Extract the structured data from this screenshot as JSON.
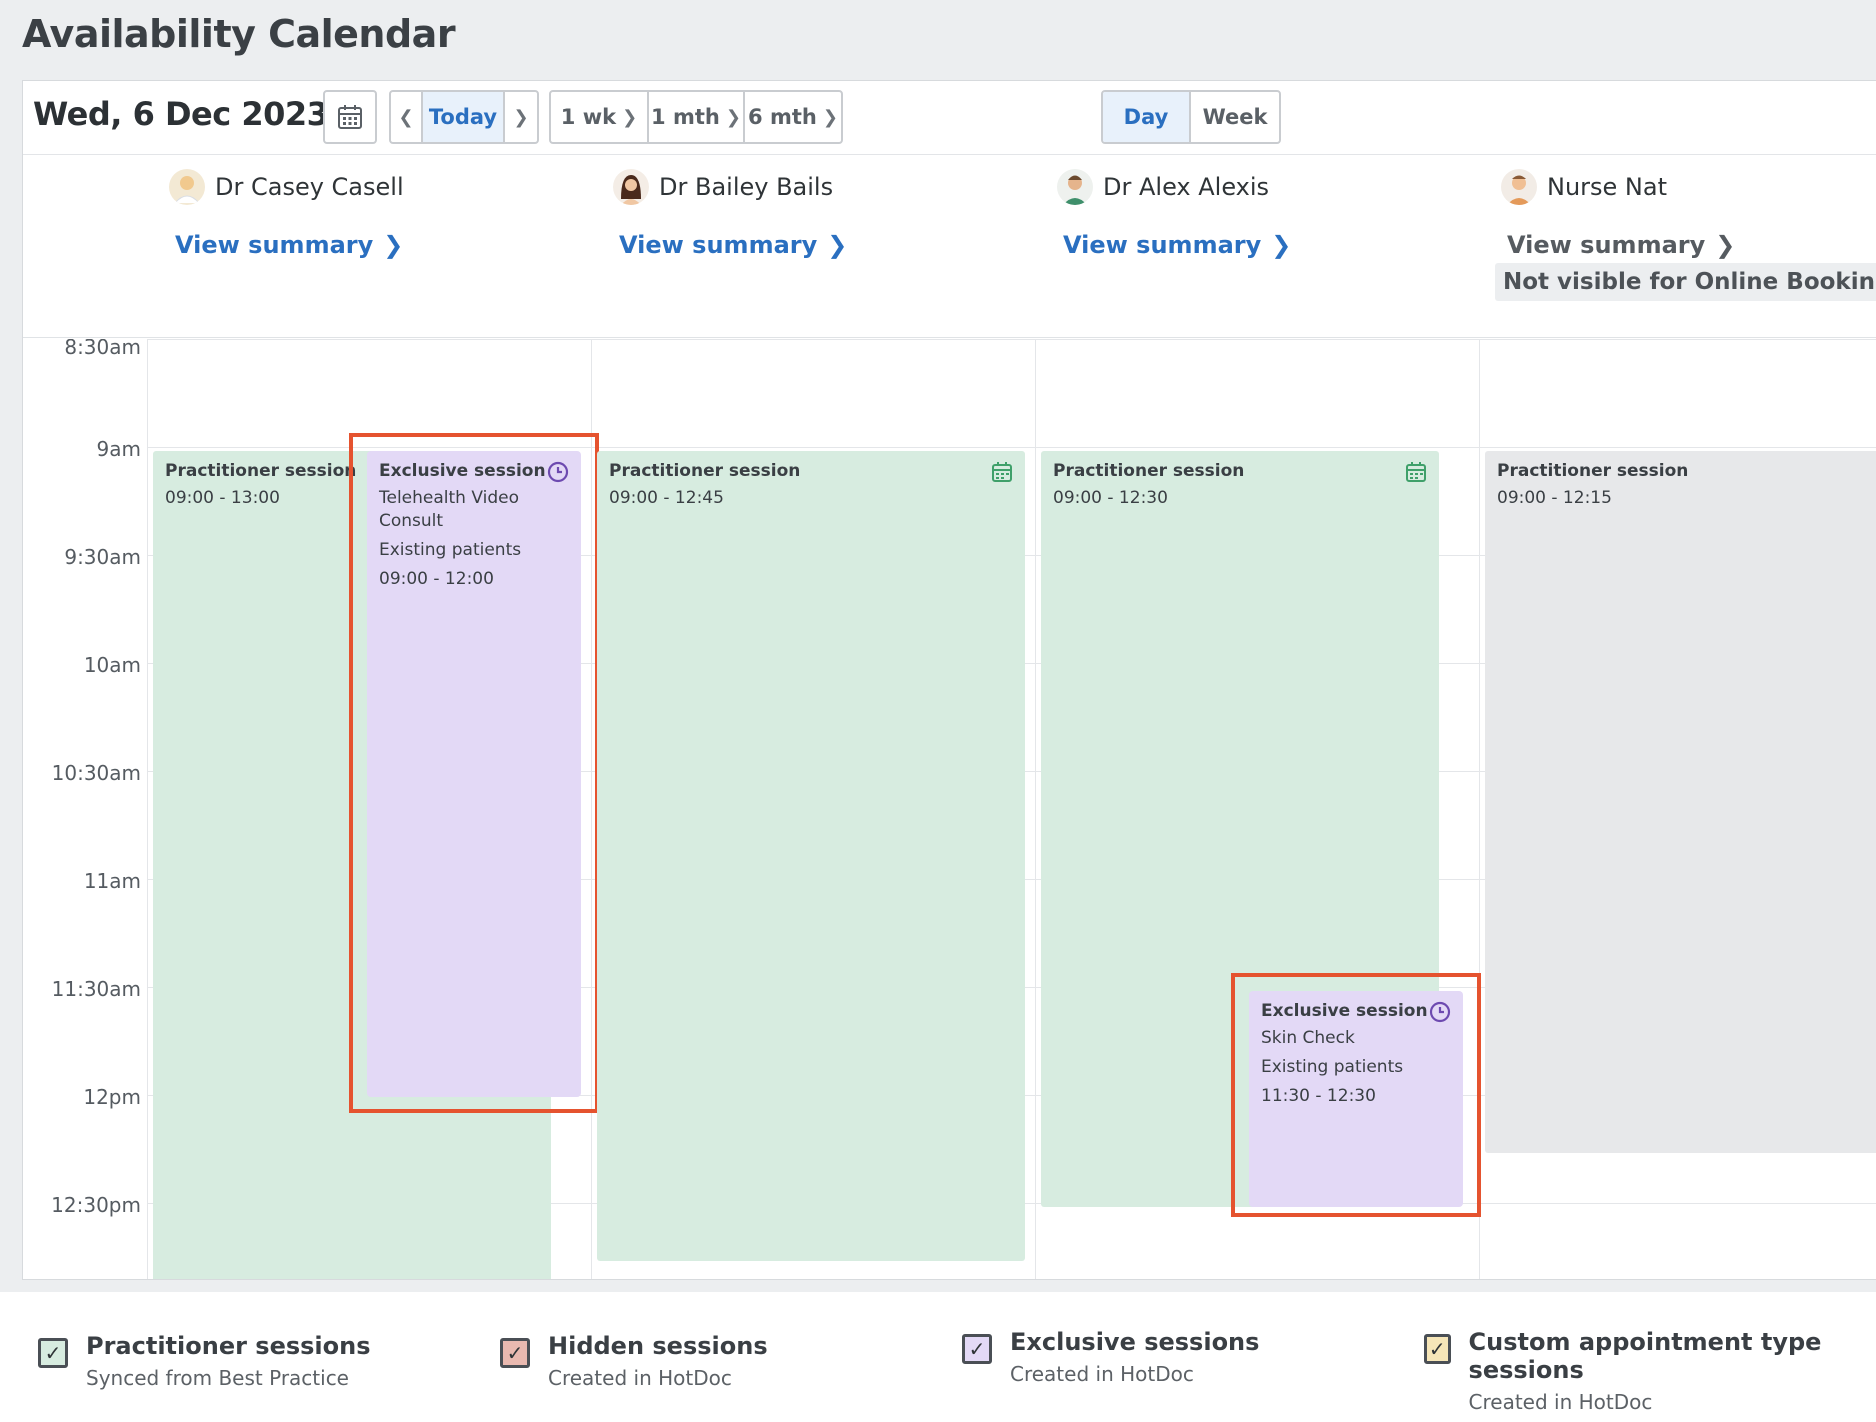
{
  "page_title": "Availability Calendar",
  "toolbar": {
    "date": "Wed, 6 Dec 2023",
    "calendar_icon": "calendar-icon",
    "today_label": "Today",
    "range_1wk": "1 wk",
    "range_1mth": "1 mth",
    "range_6mth": "6 mth",
    "view_day": "Day",
    "view_week": "Week",
    "active_view": "Day"
  },
  "practitioners": [
    {
      "name": "Dr Casey Casell",
      "summary": "View summary"
    },
    {
      "name": "Dr Bailey Bails",
      "summary": "View summary"
    },
    {
      "name": "Dr Alex Alexis",
      "summary": "View summary"
    },
    {
      "name": "Nurse Nat",
      "summary": "View summary",
      "badge": "Not visible for Online Bookings"
    }
  ],
  "times": [
    "8:30am",
    "9am",
    "9:30am",
    "10am",
    "10:30am",
    "11am",
    "11:30am",
    "12pm",
    "12:30pm"
  ],
  "sessions": {
    "casey_practitioner": {
      "title": "Practitioner session",
      "time": "09:00 - 13:00"
    },
    "casey_exclusive": {
      "title": "Exclusive session",
      "type": "Telehealth Video Consult",
      "patients": "Existing patients",
      "time": "09:00 - 12:00"
    },
    "bailey_practitioner": {
      "title": "Practitioner session",
      "time": "09:00 - 12:45"
    },
    "alex_practitioner": {
      "title": "Practitioner session",
      "time": "09:00 - 12:30"
    },
    "alex_exclusive": {
      "title": "Exclusive session",
      "type": "Skin Check",
      "patients": "Existing patients",
      "time": "11:30 - 12:30"
    },
    "nat_practitioner": {
      "title": "Practitioner session",
      "time": "09:00 - 12:15"
    }
  },
  "legend": [
    {
      "title": "Practitioner sessions",
      "sub": "Synced from Best Practice",
      "color": "#d7ece0"
    },
    {
      "title": "Hidden sessions",
      "sub": "Created in HotDoc",
      "color": "#e9b9b0"
    },
    {
      "title": "Exclusive sessions",
      "sub": "Created in HotDoc",
      "color": "#e3d9f6"
    },
    {
      "title": "Custom appointment type sessions",
      "sub": "Created in HotDoc",
      "color": "#f6e6b8"
    }
  ],
  "colors": {
    "accent": "#2a6fc0",
    "highlight": "#e5532f",
    "practitioner": "#d7ece0",
    "exclusive": "#e3d9f6"
  }
}
